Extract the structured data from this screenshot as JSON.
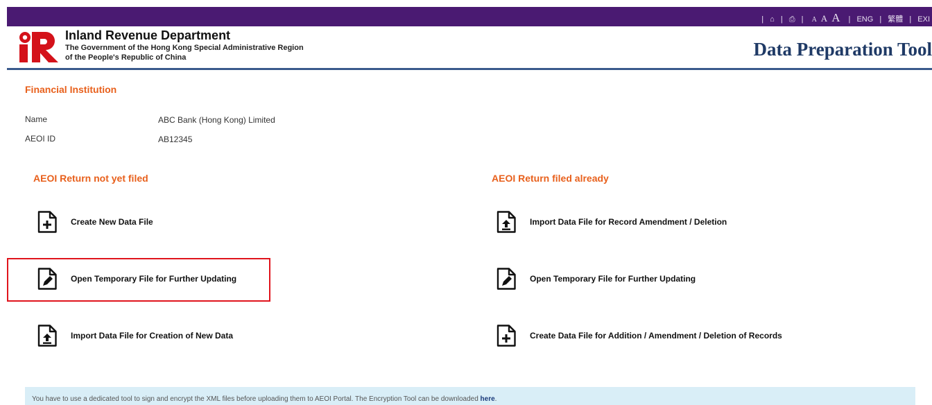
{
  "header": {
    "toplinks": {
      "home": "⌂",
      "print": "⎙",
      "font_small": "A",
      "font_medium": "A",
      "font_large": "A",
      "eng": "ENG",
      "chi": "繁體",
      "exit": "EXI"
    },
    "department": "Inland Revenue Department",
    "gov_line1": "The Government of the Hong Kong Special Administrative Region",
    "gov_line2": "of the People's Republic of China",
    "app_title": "Data Preparation Tool"
  },
  "fi": {
    "title": "Financial Institution",
    "name_label": "Name",
    "name_value": "ABC Bank (Hong Kong) Limited",
    "id_label": "AEOI ID",
    "id_value": "AB12345"
  },
  "not_filed": {
    "title": "AEOI Return not yet filed",
    "actions": [
      {
        "label": "Create New Data File",
        "icon": "file-add-icon"
      },
      {
        "label": "Open Temporary File for Further Updating",
        "icon": "file-edit-icon"
      },
      {
        "label": "Import Data File for Creation of New Data",
        "icon": "file-import-icon"
      }
    ]
  },
  "filed": {
    "title": "AEOI Return filed already",
    "actions": [
      {
        "label": "Import Data File for Record Amendment / Deletion",
        "icon": "file-import-icon"
      },
      {
        "label": "Open Temporary File for Further Updating",
        "icon": "file-edit-icon"
      },
      {
        "label": "Create Data File for Addition / Amendment / Deletion of Records",
        "icon": "file-add-icon"
      }
    ]
  },
  "notice": {
    "text": "You have to use a dedicated tool to sign and encrypt the XML files before uploading them to AEOI Portal. The Encryption Tool can be downloaded ",
    "link": "here",
    "end": "."
  },
  "colors": {
    "topbar": "#4a1a72",
    "accent_orange": "#e8601c",
    "title_blue": "#1f3a66",
    "highlight_red": "#e0141c",
    "notice_bg": "#d9eef7"
  }
}
